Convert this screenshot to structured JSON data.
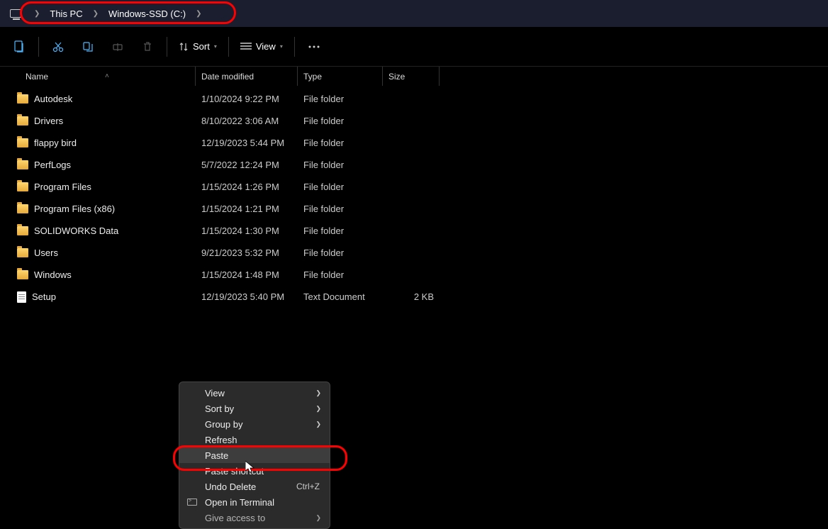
{
  "breadcrumb": {
    "items": [
      "This PC",
      "Windows-SSD (C:)"
    ]
  },
  "toolbar": {
    "sort_label": "Sort",
    "view_label": "View"
  },
  "columns": {
    "name": "Name",
    "date": "Date modified",
    "type": "Type",
    "size": "Size"
  },
  "files": [
    {
      "icon": "folder",
      "name": "Autodesk",
      "date": "1/10/2024 9:22 PM",
      "type": "File folder",
      "size": ""
    },
    {
      "icon": "folder",
      "name": "Drivers",
      "date": "8/10/2022 3:06 AM",
      "type": "File folder",
      "size": ""
    },
    {
      "icon": "folder",
      "name": "flappy bird",
      "date": "12/19/2023 5:44 PM",
      "type": "File folder",
      "size": ""
    },
    {
      "icon": "folder",
      "name": "PerfLogs",
      "date": "5/7/2022 12:24 PM",
      "type": "File folder",
      "size": ""
    },
    {
      "icon": "folder",
      "name": "Program Files",
      "date": "1/15/2024 1:26 PM",
      "type": "File folder",
      "size": ""
    },
    {
      "icon": "folder",
      "name": "Program Files (x86)",
      "date": "1/15/2024 1:21 PM",
      "type": "File folder",
      "size": ""
    },
    {
      "icon": "folder",
      "name": "SOLIDWORKS Data",
      "date": "1/15/2024 1:30 PM",
      "type": "File folder",
      "size": ""
    },
    {
      "icon": "folder",
      "name": "Users",
      "date": "9/21/2023 5:32 PM",
      "type": "File folder",
      "size": ""
    },
    {
      "icon": "folder",
      "name": "Windows",
      "date": "1/15/2024 1:48 PM",
      "type": "File folder",
      "size": ""
    },
    {
      "icon": "file",
      "name": "Setup",
      "date": "12/19/2023 5:40 PM",
      "type": "Text Document",
      "size": "2 KB"
    }
  ],
  "context_menu": {
    "view": "View",
    "sort_by": "Sort by",
    "group_by": "Group by",
    "refresh": "Refresh",
    "paste": "Paste",
    "paste_shortcut": "Paste shortcut",
    "undo_delete": "Undo Delete",
    "undo_delete_key": "Ctrl+Z",
    "open_terminal": "Open in Terminal",
    "give_access": "Give access to"
  }
}
